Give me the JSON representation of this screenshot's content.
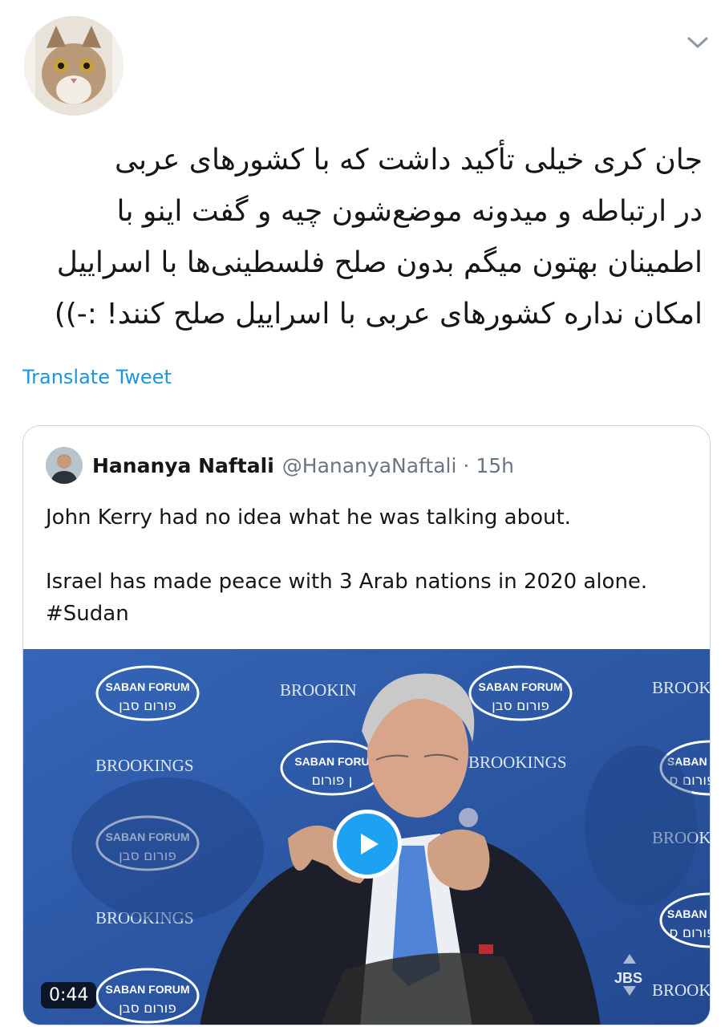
{
  "tweet": {
    "text_lines": [
      "جان کری خیلی تأکید داشت که با کشورهای عربی",
      "در ارتباطه و میدونه موضع‌شون چیه و گفت اینو با",
      "اطمینان بهتون میگم بدون صلح فلسطینی‌ها با اسراییل",
      "امکان نداره کشورهای عربی با اسراییل صلح کنند! :-))"
    ],
    "translate_label": "Translate Tweet"
  },
  "quoted": {
    "name": "Hananya Naftali",
    "handle": "@HananyaNaftali",
    "separator": "·",
    "time": "15h",
    "body_line1": "John Kerry had no idea what he was talking about.",
    "body_line2": "Israel has made peace with 3 Arab nations in 2020 alone.",
    "hashtag": "#Sudan"
  },
  "video": {
    "duration": "0:44",
    "backdrop_text": {
      "forum": "SABAN FORUM",
      "forum_hebrew": "פורום סבן",
      "brookings": "BROOKINGS",
      "brookings_cut": "BROOKIN",
      "brook": "BROOK",
      "saban_cut": "SABAN F",
      "forum_cut": "SABAN FORU",
      "hebrew_cut": "ן פורום",
      "hebrew_cut2": "פורום ס",
      "watermark": "JBS"
    }
  },
  "colors": {
    "link": "#1b95e0",
    "accent": "#1da1f2",
    "video_bg": "#2c57a8",
    "border": "#ccd6dd"
  },
  "icons": [
    "chevron-down-icon",
    "play-icon"
  ]
}
